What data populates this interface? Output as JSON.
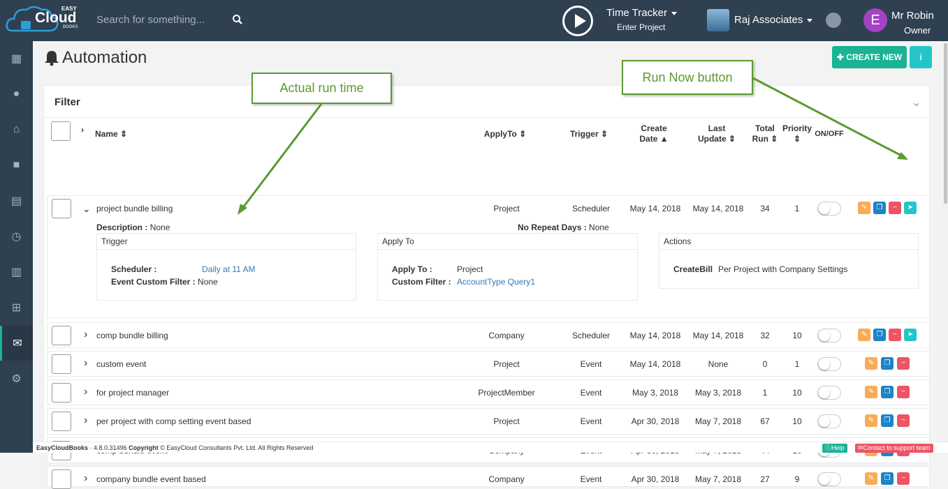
{
  "header": {
    "search_placeholder": "Search for something...",
    "time_tracker": "Time Tracker",
    "enter_project": "Enter Project",
    "company": "Raj Associates",
    "user_initial": "E",
    "user_name": "Mr Robin",
    "user_role": "Owner",
    "logo_text": "Cloud",
    "logo_small": "EASY",
    "logo_books": "BOOKS"
  },
  "page": {
    "title": "Automation",
    "create_new": "✚ CREATE NEW",
    "info": "i"
  },
  "filter": {
    "title": "Filter"
  },
  "columns": {
    "name": "Name",
    "applyto": "ApplyTo",
    "trigger": "Trigger",
    "create": "Create",
    "create2": "Date",
    "last": "Last",
    "last2": "Update",
    "total": "Total",
    "total2": "Run",
    "priority": "Priority",
    "onoff": "ON/OFF"
  },
  "expanded": {
    "description_label": "Description :",
    "description": "None",
    "norepeat_label": "No Repeat Days :",
    "norepeat": "None",
    "trigger_title": "Trigger",
    "scheduler_label": "Scheduler :",
    "scheduler": "Daily at 11 AM",
    "event_filter_label": "Event Custom Filter :",
    "event_filter": "None",
    "applyto_title": "Apply To",
    "applyto_label": "Apply To :",
    "applyto": "Project",
    "custom_filter_label": "Custom Filter :",
    "custom_filter": "AccountType Query1",
    "actions_title": "Actions",
    "action_name": "CreateBill",
    "action_desc": "Per Project with Company Settings"
  },
  "rows": [
    {
      "name": "project bundle billing",
      "apply": "Project",
      "trigger": "Scheduler",
      "create": "May 14, 2018",
      "update": "May 14, 2018",
      "total": "34",
      "priority": "1"
    },
    {
      "name": "comp bundle billing",
      "apply": "Company",
      "trigger": "Scheduler",
      "create": "May 14, 2018",
      "update": "May 14, 2018",
      "total": "32",
      "priority": "10"
    },
    {
      "name": "custom event",
      "apply": "Project",
      "trigger": "Event",
      "create": "May 14, 2018",
      "update": "None",
      "total": "0",
      "priority": "1"
    },
    {
      "name": "for project manager",
      "apply": "ProjectMember",
      "trigger": "Event",
      "create": "May 3, 2018",
      "update": "May 3, 2018",
      "total": "1",
      "priority": "10"
    },
    {
      "name": "per project with comp setting event based",
      "apply": "Project",
      "trigger": "Event",
      "create": "Apr 30, 2018",
      "update": "May 7, 2018",
      "total": "67",
      "priority": "10"
    },
    {
      "name": "comp bundle event",
      "apply": "Company",
      "trigger": "Event",
      "create": "Apr 30, 2018",
      "update": "May 7, 2018",
      "total": "44",
      "priority": "10"
    },
    {
      "name": "company bundle event based",
      "apply": "Company",
      "trigger": "Event",
      "create": "Apr 30, 2018",
      "update": "May 7, 2018",
      "total": "27",
      "priority": "9"
    }
  ],
  "callouts": {
    "run_time": "Actual run time",
    "run_now": "Run Now button"
  },
  "footer": {
    "brand": "EasyCloudBooks",
    "version": "· 4.8.0.31496",
    "copyright_label": "Copyright",
    "copyright": "© EasyCloud Consultants Pvt. Ltd. All Rights Reserved",
    "help": "Help",
    "support": "Contact to support team"
  },
  "colors": {
    "sidebar": "#2f4050",
    "primary": "#1ab394",
    "info": "#23c6c8",
    "callout": "#5a9a2e"
  }
}
